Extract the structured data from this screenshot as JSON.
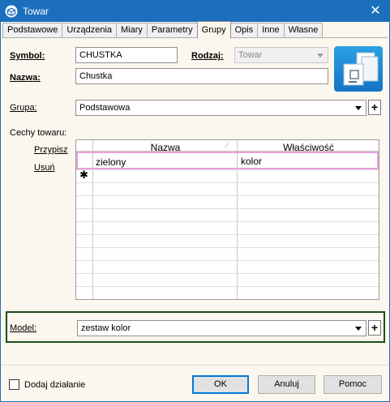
{
  "window": {
    "title": "Towar",
    "close_glyph": "✕",
    "app_icon": "package-icon"
  },
  "tabs": [
    {
      "label": "Podstawowe",
      "active": false
    },
    {
      "label": "Urządzenia",
      "active": false
    },
    {
      "label": "Miary",
      "active": false
    },
    {
      "label": "Parametry",
      "active": false
    },
    {
      "label": "Grupy",
      "active": true
    },
    {
      "label": "Opis",
      "active": false
    },
    {
      "label": "Inne",
      "active": false
    },
    {
      "label": "Własne",
      "active": false
    }
  ],
  "form": {
    "symbol_label": "Symbol:",
    "symbol_value": "CHUSTKA",
    "rodzaj_label": "Rodzaj:",
    "rodzaj_value": "Towar",
    "nazwa_label": "Nazwa:",
    "nazwa_value": "Chustka",
    "grupa_label": "Grupa:",
    "grupa_value": "Podstawowa",
    "cechy_label": "Cechy towaru:",
    "przypisz_link": "Przypisz",
    "usun_link": "Usuń",
    "model_label": "Model:",
    "model_value": "zestaw kolor",
    "plus_glyph": "+"
  },
  "grid": {
    "columns": [
      "Nazwa",
      "Właściwość"
    ],
    "rows": [
      {
        "nazwa": "zielony",
        "wlasciwosc": "kolor"
      }
    ],
    "new_row_marker": "✱",
    "sort_glyph": "⟋"
  },
  "footer": {
    "checkbox_label": "Dodaj działanie",
    "checkbox_checked": false,
    "ok_label": "OK",
    "anuluj_label": "Anuluj",
    "pomoc_label": "Pomoc"
  },
  "colors": {
    "titlebar": "#1b6fbd",
    "panel_bg": "#fcf7ee",
    "selected_row_border": "#e6a1dd",
    "model_border": "#1e4d1e",
    "default_button_border": "#0078d7"
  }
}
